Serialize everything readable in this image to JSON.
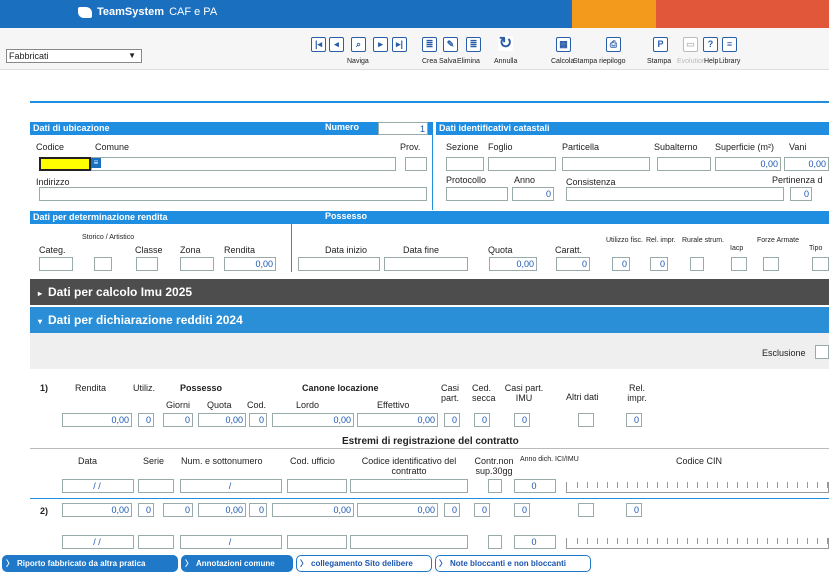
{
  "app": {
    "brand": "TeamSystem",
    "product": "CAF e PA"
  },
  "selector": {
    "value": "Fabbricati"
  },
  "toolbar": {
    "naviga": "Naviga",
    "crea": "Crea",
    "salva": "Salva",
    "elimina": "Elimina",
    "annulla": "Annulla",
    "calcola": "Calcola",
    "stampa_riepilogo": "Stampa riepilogo",
    "stampa": "Stampa",
    "evolution": "Evolution",
    "help": "Help",
    "library": "Library"
  },
  "ubicazione": {
    "title": "Dati di ubicazione",
    "numero_label": "Numero",
    "numero": "1",
    "codice": "Codice",
    "comune": "Comune",
    "prov": "Prov.",
    "indirizzo": "Indirizzo"
  },
  "catastali": {
    "title": "Dati identificativi catastali",
    "sezione": "Sezione",
    "foglio": "Foglio",
    "particella": "Particella",
    "subalterno": "Subalterno",
    "superficie": "Superficie (m²)",
    "vani": "Vani",
    "superficie_val": "0,00",
    "vani_val": "0,00",
    "protocollo": "Protocollo",
    "anno": "Anno",
    "anno_val": "0",
    "consistenza": "Consistenza",
    "pertinenza": "Pertinenza d",
    "pertinenza_val": "0"
  },
  "rendita": {
    "title": "Dati per determinazione rendita",
    "categ": "Categ.",
    "storico": "Storico / Artistico",
    "classe": "Classe",
    "zona": "Zona",
    "rendita": "Rendita",
    "rendita_val": "0,00"
  },
  "possesso": {
    "title": "Possesso",
    "data_inizio": "Data inizio",
    "data_fine": "Data fine",
    "quota": "Quota",
    "quota_val": "0,00",
    "caratt": "Caratt.",
    "caratt_val": "0",
    "utilizzo": "Utilizzo fisc.",
    "utilizzo_val": "0",
    "rel": "Rel. impr.",
    "rel_val": "0",
    "rurale": "Rurale strum.",
    "iacp": "Iacp",
    "forze": "Forze Armate",
    "tipo": "Tipo"
  },
  "imu": {
    "title": "Dati per calcolo Imu 2025"
  },
  "redditi": {
    "title": "Dati per dichiarazione redditi 2024",
    "esclusione": "Esclusione"
  },
  "tab": {
    "r1": "1)",
    "r2": "2)",
    "rendita": "Rendita",
    "utiliz": "Utiliz.",
    "possesso": "Possesso",
    "giorni": "Giorni",
    "quota": "Quota",
    "cod": "Cod.",
    "canone": "Canone locazione",
    "lordo": "Lordo",
    "effettivo": "Effettivo",
    "casi": "Casi part.",
    "ced": "Ced. secca",
    "casi_imu": "Casi part. IMU",
    "altri": "Altri dati",
    "rel": "Rel. impr."
  },
  "row1": {
    "rendita": "0,00",
    "utiliz": "0",
    "giorni": "0",
    "quota": "0,00",
    "cod": "0",
    "lordo": "0,00",
    "effettivo": "0,00",
    "casi": "0",
    "ced": "0",
    "imu": "0",
    "rel": "0"
  },
  "row2": {
    "rendita": "0,00",
    "utiliz": "0",
    "giorni": "0",
    "quota": "0,00",
    "cod": "0",
    "lordo": "0,00",
    "effettivo": "0,00",
    "casi": "0",
    "ced": "0",
    "imu": "0",
    "rel": "0"
  },
  "estremi": {
    "title": "Estremi di registrazione del contratto",
    "data": "Data",
    "serie": "Serie",
    "num": "Num. e sottonumero",
    "ufficio": "Cod. ufficio",
    "codice_id": "Codice identificativo del contratto",
    "contr": "Contr.non sup.30gg",
    "anno_dich": "Anno dich. ICI/IMU",
    "cin": "Codice CIN",
    "date1": "/ /",
    "slash1": "/",
    "anno1": "0",
    "date2": "/ /",
    "slash2": "/",
    "anno2": "0"
  },
  "bottom": {
    "b1": "Riporto fabbricato da altra pratica",
    "b2": "Annotazioni comune",
    "b3": "collegamento Sito delibere",
    "b4": "Note bloccanti e non bloccanti"
  },
  "colors": {
    "accent": "#1f8de0",
    "band_dark": "#4d4d4d",
    "band_blue": "#2a8fd6"
  }
}
